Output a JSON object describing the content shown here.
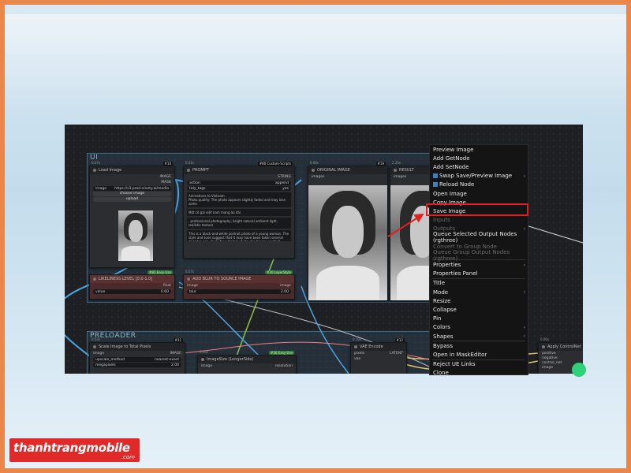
{
  "canvas": {
    "groups": {
      "ui": {
        "title": "UI"
      },
      "preloader": {
        "title": "PRELOADER"
      }
    },
    "nodes": {
      "load_image": {
        "title": "Load Image",
        "badge": "#10",
        "timing": "0.07s",
        "outputs": [
          "IMAGE",
          "MASK"
        ],
        "image_field": "image",
        "image_value": "https://s3.prod.ninety.ai/media",
        "choose_label": "choose image",
        "upload_label": "upload"
      },
      "prompt": {
        "title": "PROMPT",
        "badge": "#80 Custom-Scripts",
        "timing": "0.01s",
        "output": "STRING",
        "action_label": "action",
        "action_value": "append",
        "tidy_label": "tidy_tags",
        "tidy_value": "yes",
        "text1": "Animations to Vietnam.",
        "text2": "Photo quality: The photo appears slightly faded and may lose some",
        "text3": "Một cô gái việt nam mang áo dài",
        "text4": ", professional photography, bright natural ambient light, realistic texture",
        "text5": "This is a black-and-white portrait photo of a young woman. The style and tone suggest that it may have been taken several decades ago, likely for a formal photo of a Korean portrait, expression"
      },
      "original_image": {
        "title": "ORIGINAL IMAGE",
        "badge": "#19",
        "timing": "0.00s",
        "input": "images"
      },
      "result": {
        "title": "RESULT",
        "timing": "2.25s",
        "input": "images"
      },
      "likeliness": {
        "title": "LIKELINESS LEVEL [0.0-1.0]",
        "badge": "#81 Easy-Use",
        "output": "float",
        "field": "value",
        "value": "0.60"
      },
      "add_blur": {
        "title": "ADD BLUR TO SOURCE IMAGE",
        "badge": "#30 LayerStyle",
        "timing": "0.07s",
        "in_label": "image",
        "out_label": "image",
        "field": "blur",
        "value": "2.00"
      },
      "scale_image": {
        "title": "Scale Image to Total Pixels",
        "badge": "#31",
        "timing": "0.03s",
        "in_label": "image",
        "out_label": "IMAGE",
        "f1": "upscale_method",
        "v1": "nearest-exact",
        "f2": "megapixels",
        "v2": "2.00"
      },
      "image_size": {
        "title": "ImageSize (LongerSide)",
        "badge": "#36 Easy-Use",
        "timing": "0.00s",
        "in_label": "image",
        "out_label": "resolution"
      },
      "vae_encode": {
        "title": "VAE Encode",
        "badge": "#12",
        "timing": "0.10s",
        "in1": "pixels",
        "in2": "vae",
        "out_label": "LATENT"
      },
      "apply_controlnet": {
        "title": "Apply ControlNet",
        "timing": "0.00s",
        "inputs": [
          "positive",
          "negative",
          "control_net",
          "image"
        ]
      }
    }
  },
  "context_menu": {
    "items": [
      {
        "label": "Preview Image"
      },
      {
        "label": "Add GetNode"
      },
      {
        "label": "Add SetNode"
      },
      {
        "label": "Swap Save/Preview Image",
        "icon": "swap-icon",
        "submenu": true
      },
      {
        "label": "Reload Node",
        "icon": "reload-icon"
      },
      {
        "label": "Open Image"
      },
      {
        "label": "Copy Image"
      },
      {
        "label": "Save Image",
        "highlight": true
      },
      {
        "label": "Inputs",
        "disabled": true
      },
      {
        "label": "Outputs",
        "disabled": true,
        "submenu": true
      },
      {
        "label": "Queue Selected Output Nodes (rgthree)"
      },
      {
        "label": "Convert to Group Node",
        "disabled": true
      },
      {
        "label": "Queue Group Output Nodes (rgthree)",
        "disabled": true
      },
      {
        "separator": true
      },
      {
        "label": "Properties",
        "submenu": true
      },
      {
        "label": "Properties Panel"
      },
      {
        "separator": true
      },
      {
        "label": "Title"
      },
      {
        "label": "Mode",
        "submenu": true
      },
      {
        "label": "Resize"
      },
      {
        "label": "Collapse"
      },
      {
        "label": "Pin"
      },
      {
        "label": "Colors",
        "submenu": true
      },
      {
        "label": "Shapes",
        "submenu": true
      },
      {
        "separator": true
      },
      {
        "label": "Bypass"
      },
      {
        "label": "Open in MaskEditor"
      },
      {
        "separator": true
      },
      {
        "label": "Reject UE Links"
      },
      {
        "label": "Clone"
      }
    ],
    "highlight_color": "#e02020"
  },
  "watermark": {
    "brand": "thanhtrangmobile",
    "suffix": ".com",
    "color": "#e02a2a"
  },
  "colors": {
    "frame": "#e9864a",
    "canvas": "#1f2023",
    "group_border": "#3e6a86"
  }
}
